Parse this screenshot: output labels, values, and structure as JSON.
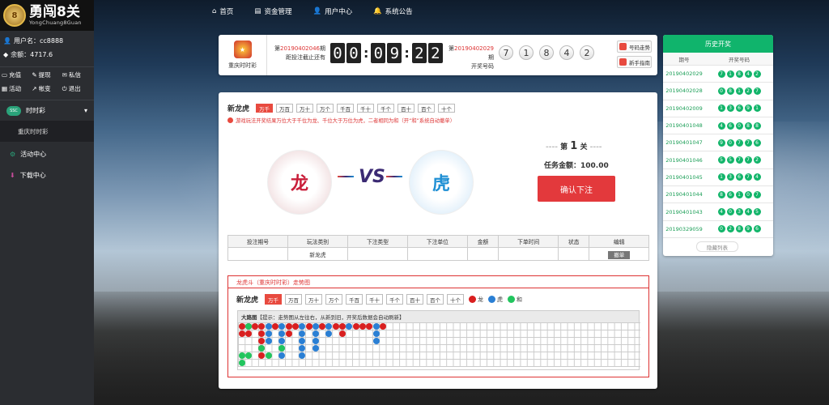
{
  "brand": {
    "title": "勇闯8关",
    "subtitle": "YongChuang8Guan",
    "badge": "8"
  },
  "user": {
    "username_label": "用户名：cc8888",
    "balance_label": "余额：4717.6"
  },
  "quick_links": [
    "充值",
    "提现",
    "私信",
    "活动",
    "帐变",
    "退出"
  ],
  "sidebar": {
    "group": "时时彩",
    "group_badge": "SSC",
    "sub_item": "重庆时时彩",
    "activity": "活动中心",
    "download": "下载中心"
  },
  "topnav": [
    "首页",
    "资金管理",
    "用户中心",
    "系统公告"
  ],
  "header": {
    "lottery_name": "重庆时时彩",
    "current_issue_prefix": "第",
    "current_issue": "20190402046",
    "current_issue_suffix": "期",
    "deadline_label": "距投注截止还有",
    "countdown": [
      "0",
      "0",
      "0",
      "9",
      "2",
      "2"
    ],
    "last_issue": "20190402029",
    "last_issue_label": "开奖号码",
    "last_numbers": [
      "7",
      "1",
      "8",
      "4",
      "2"
    ],
    "trend_btn": "号码走势",
    "guide_btn": "新手指南"
  },
  "play": {
    "title": "新龙虎",
    "options": [
      "万千",
      "万百",
      "万十",
      "万个",
      "千百",
      "千十",
      "千个",
      "百十",
      "百个",
      "十个"
    ],
    "active": "万千",
    "tip": "游戏玩法开奖结果万位大于千位为龙、千位大于万位为虎，二者相同为和（开“和”系统自动撤单）"
  },
  "battle": {
    "dragon": "龙",
    "tiger": "虎",
    "vs": "VS",
    "level_prefix": "第",
    "level": "1",
    "level_suffix": "关",
    "amount_label": "任务金额：",
    "amount": "100.00",
    "confirm": "确认下注"
  },
  "bets_table": {
    "headers": [
      "投注期号",
      "玩法类别",
      "下注类型",
      "下注单位",
      "金额",
      "下单时间",
      "状态",
      "编辑"
    ],
    "row": [
      "",
      "新龙虎",
      "",
      "",
      "",
      "",
      "",
      ""
    ],
    "action": "撤单"
  },
  "trend": {
    "title": "龙虎斗（重庆时时彩）走势图",
    "play_title": "新龙虎",
    "options": [
      "万千",
      "万百",
      "万十",
      "万个",
      "千百",
      "千十",
      "千个",
      "百十",
      "百个",
      "十个"
    ],
    "legend": [
      {
        "label": "龙",
        "color": "#d91f1f"
      },
      {
        "label": "虎",
        "color": "#2a7fd4"
      },
      {
        "label": "和",
        "color": "#22c55e"
      }
    ],
    "road_label": "大路图",
    "road_hint": "【提示：走势图从左往右，从新到旧，开奖后数据会自动刷新】",
    "columns": [
      [
        "D",
        "D"
      ],
      [
        "D",
        "D"
      ],
      [
        "D"
      ],
      [
        "D",
        "D",
        "D",
        "D",
        "D"
      ],
      [
        "T",
        "T",
        "T"
      ],
      [
        "D"
      ],
      [
        "T",
        "T",
        "T",
        "T",
        "T"
      ],
      [
        "D",
        "D"
      ],
      [
        "D"
      ],
      [
        "T",
        "T",
        "T",
        "T",
        "T"
      ],
      [
        "D"
      ],
      [
        "T",
        "T",
        "T",
        "T"
      ],
      [
        "D"
      ],
      [
        "T",
        "T"
      ],
      [
        "D"
      ],
      [
        "D",
        "D"
      ],
      [
        "T"
      ],
      [
        "D"
      ],
      [
        "D"
      ],
      [
        "D"
      ],
      [
        "T",
        "T",
        "T"
      ],
      [
        "D"
      ]
    ],
    "ties": [
      [
        0,
        1
      ],
      [
        3,
        3
      ],
      [
        4,
        0
      ],
      [
        4,
        1
      ],
      [
        5,
        0
      ],
      [
        4,
        4
      ],
      [
        3,
        6
      ]
    ]
  },
  "history": {
    "title": "历史开奖",
    "col_issue": "期号",
    "col_numbers": "开奖号码",
    "rows": [
      {
        "issue": "20190402029",
        "nums": [
          "7",
          "1",
          "8",
          "4",
          "2"
        ]
      },
      {
        "issue": "20190402028",
        "nums": [
          "0",
          "8",
          "1",
          "2",
          "7"
        ]
      },
      {
        "issue": "20190402009",
        "nums": [
          "1",
          "3",
          "6",
          "9",
          "1"
        ]
      },
      {
        "issue": "20190401048",
        "nums": [
          "4",
          "6",
          "0",
          "8",
          "8"
        ]
      },
      {
        "issue": "20190401047",
        "nums": [
          "9",
          "0",
          "7",
          "7",
          "6"
        ]
      },
      {
        "issue": "20190401046",
        "nums": [
          "5",
          "5",
          "7",
          "7",
          "2"
        ]
      },
      {
        "issue": "20190401045",
        "nums": [
          "1",
          "3",
          "6",
          "7",
          "4"
        ]
      },
      {
        "issue": "20190401044",
        "nums": [
          "8",
          "6",
          "1",
          "0",
          "7"
        ]
      },
      {
        "issue": "20190401043",
        "nums": [
          "4",
          "0",
          "3",
          "4",
          "5"
        ]
      },
      {
        "issue": "20190329059",
        "nums": [
          "0",
          "2",
          "8",
          "9",
          "6"
        ]
      }
    ],
    "more": "隐藏列表"
  }
}
